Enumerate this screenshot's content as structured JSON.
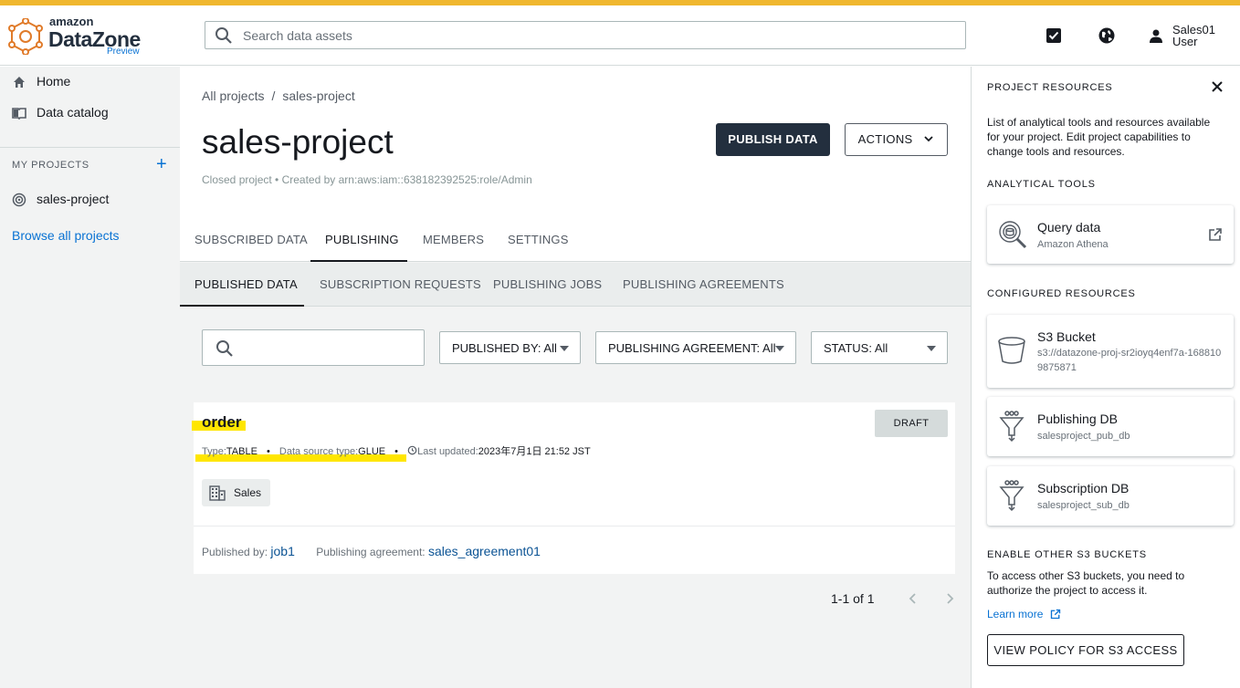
{
  "colors": {
    "accent_stripe": "#f0b72f",
    "link": "#0972d3",
    "highlight": "#ffe600",
    "primary_button": "#232f3e"
  },
  "header": {
    "logo": {
      "line1": "amazon",
      "line2": "DataZone",
      "tag": "Preview"
    },
    "search_placeholder": "Search data assets",
    "icons": [
      "tasks-checkbox-icon",
      "globe-icon",
      "user-icon"
    ],
    "user": {
      "name_line1": "Sales01",
      "name_line2": "User"
    }
  },
  "sidebar": {
    "items": [
      {
        "label": "Home",
        "icon": "home-icon"
      },
      {
        "label": "Data catalog",
        "icon": "book-icon"
      }
    ],
    "projects_heading": "MY PROJECTS",
    "projects": [
      {
        "label": "sales-project",
        "icon": "project-icon"
      }
    ],
    "browse_link": "Browse all projects"
  },
  "main": {
    "breadcrumb": {
      "root": "All projects",
      "separator": "/",
      "current": "sales-project"
    },
    "title": "sales-project",
    "subtitle": "Closed project • Created by arn:aws:iam::638182392525:role/Admin",
    "publish_button": "PUBLISH DATA",
    "actions_button": "ACTIONS",
    "tabs": [
      "SUBSCRIBED DATA",
      "PUBLISHING",
      "MEMBERS",
      "SETTINGS"
    ],
    "active_tab": "PUBLISHING",
    "subtabs": [
      "PUBLISHED DATA",
      "SUBSCRIPTION REQUESTS",
      "PUBLISHING JOBS",
      "PUBLISHING AGREEMENTS"
    ],
    "active_subtab": "PUBLISHED DATA",
    "filters": {
      "search_value": "",
      "published_by": "PUBLISHED BY: All",
      "agreement": "PUBLISHING AGREEMENT: All",
      "status": "STATUS: All"
    },
    "asset": {
      "name": "order",
      "type_label": "Type:",
      "type_value": "TABLE",
      "source_label": "Data source type:",
      "source_value": "GLUE",
      "updated_label": "Last updated:",
      "updated_value": "2023年7月1日 21:52 JST",
      "status": "DRAFT",
      "chip": "Sales",
      "published_by_label": "Published by:",
      "published_by_value": "job1",
      "agreement_label": "Publishing agreement:",
      "agreement_value": "sales_agreement01"
    },
    "pagination": "1-1 of 1"
  },
  "panel": {
    "heading": "PROJECT RESOURCES",
    "description": "List of analytical tools and resources available for your project. Edit project capabilities to change tools and resources.",
    "analytical_heading": "ANALYTICAL TOOLS",
    "tool": {
      "title": "Query data",
      "subtitle": "Amazon Athena"
    },
    "configured_heading": "CONFIGURED RESOURCES",
    "resources": [
      {
        "title": "S3 Bucket",
        "subtitle": "s3://datazone-proj-sr2ioyq4enf7a-1688109875871",
        "icon": "bucket-icon"
      },
      {
        "title": "Publishing DB",
        "subtitle": "salesproject_pub_db",
        "icon": "funnel-icon"
      },
      {
        "title": "Subscription DB",
        "subtitle": "salesproject_sub_db",
        "icon": "funnel-icon"
      }
    ],
    "enable_heading": "ENABLE OTHER S3 BUCKETS",
    "enable_desc": "To access other S3 buckets, you need to authorize the project to access it.",
    "learn_more": "Learn more",
    "policy_button": "VIEW POLICY FOR S3 ACCESS"
  }
}
